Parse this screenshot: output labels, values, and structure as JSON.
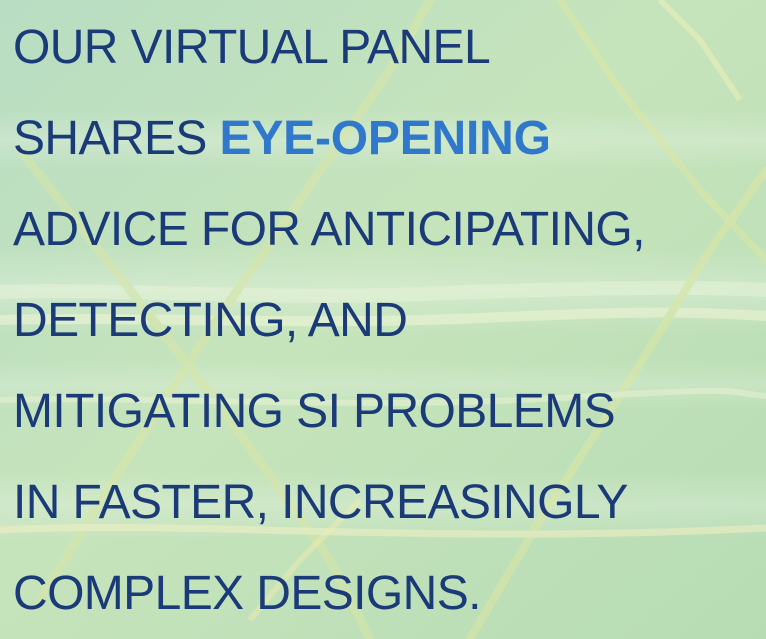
{
  "headline": {
    "line1": "OUR VIRTUAL PANEL",
    "line2_prefix": "SHARES ",
    "line2_highlight": "EYE-OPENING",
    "line3": "ADVICE FOR ANTICIPATING,",
    "line4": "DETECTING, AND",
    "line5": "MITIGATING SI PROBLEMS",
    "line6": "IN FASTER, INCREASINGLY",
    "line7": "COMPLEX DESIGNS."
  },
  "colors": {
    "text": "#1a3a78",
    "highlight": "#2f78cc",
    "background": "#c3e2c0"
  }
}
